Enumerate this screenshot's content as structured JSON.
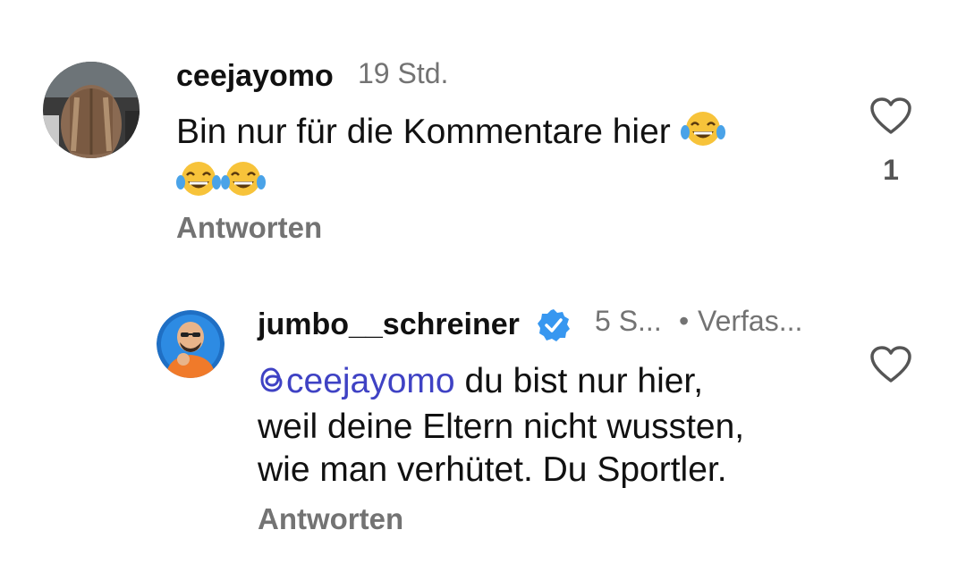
{
  "comments": [
    {
      "username": "ceejayomo",
      "time": "19 Std.",
      "text_line1": "Bin nur für die Kommentare hier",
      "emoji_name": "face-with-tears-of-joy-icon",
      "reply_label": "Antworten",
      "like_count": "1"
    },
    {
      "username": "jumbo__schreiner",
      "verified": true,
      "time": "5 S...",
      "separator": "•",
      "author_label": "Verfas...",
      "mention": "@ceejayomo",
      "text_part1": " du bist nur hier,",
      "text_line2": "weil deine Eltern nicht wussten,",
      "text_line3": "wie man verhütet.  Du Sportler.",
      "reply_label": "Antworten"
    }
  ],
  "colors": {
    "text": "#111111",
    "muted": "#737373",
    "mention": "#3f42c4",
    "verified": "#3797f0"
  }
}
